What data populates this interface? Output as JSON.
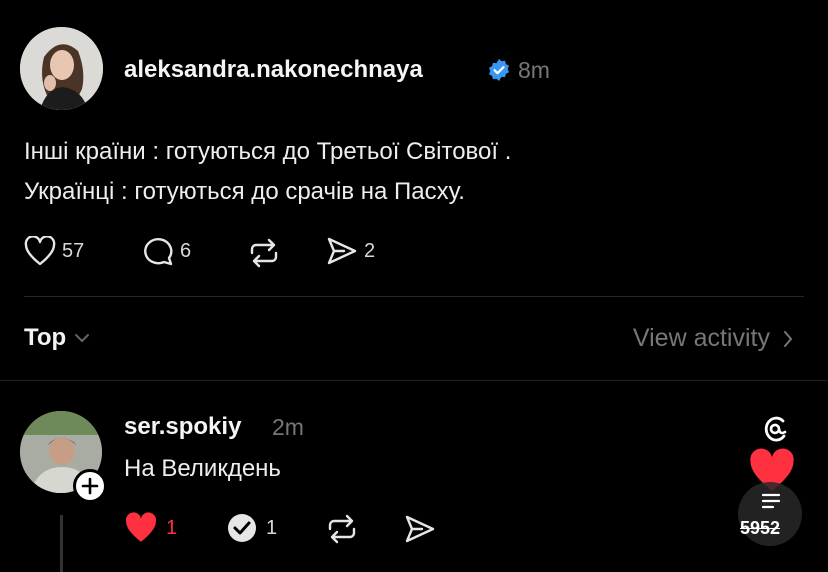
{
  "post": {
    "username": "aleksandra.nakonechnaya",
    "verified_icon": "verified-badge-icon",
    "time": "8m",
    "lines": [
      "Інші країни : готуються до Третьої Світової .",
      "Українці : готуються до срачів на Пасху."
    ],
    "stats": {
      "likes": "57",
      "replies": "6",
      "shares": "2"
    }
  },
  "filter": {
    "label": "Top",
    "view_activity": "View activity"
  },
  "reply": {
    "username": "ser.spokiy",
    "time": "2m",
    "text": "На Великдень",
    "stats": {
      "likes": "1",
      "reposts": "1"
    },
    "floating_count": "5952"
  },
  "colors": {
    "background": "#000000",
    "verified": "#3897f0",
    "like_red": "#ff3040",
    "muted": "#777777"
  }
}
